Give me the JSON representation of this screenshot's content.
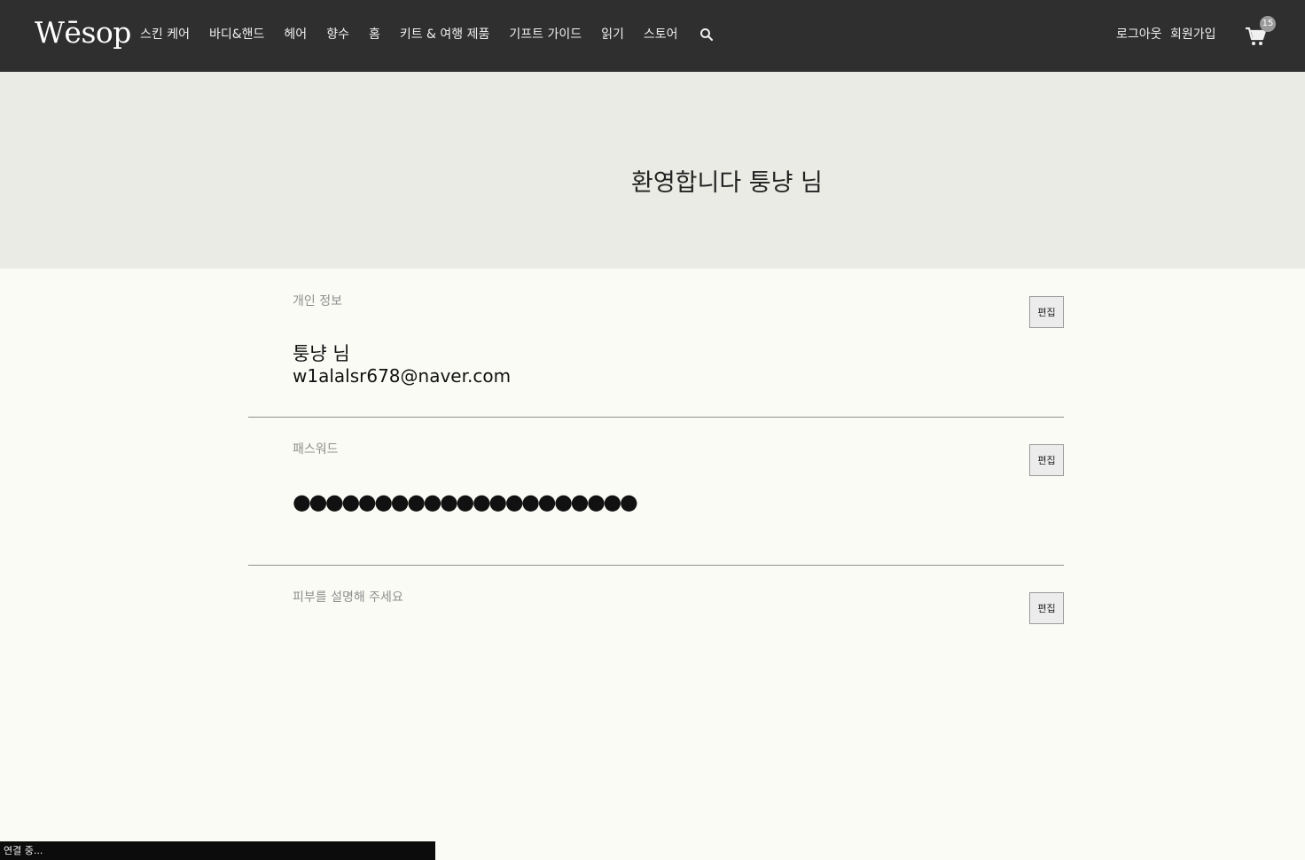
{
  "header": {
    "logo": "Wēsop",
    "nav_items": [
      "스킨 케어",
      "바디&핸드",
      "헤어",
      "향수",
      "홈",
      "키트 & 여행 제품",
      "기프트 가이드",
      "읽기",
      "스토어"
    ],
    "search_icon": "search-icon",
    "logout_label": "로그아웃",
    "signup_label": "회원가입",
    "cart_icon": "cart-icon",
    "cart_count": "15"
  },
  "hero": {
    "title": "환영합니다 퉁냥 님"
  },
  "profile": {
    "label": "개인 정보",
    "name": "퉁냥 님",
    "email": "w1alalsr678@naver.com",
    "edit_label": "편집"
  },
  "password": {
    "label": "패스워드",
    "mask": "●●●●●●●●●●●●●●●●●●●●●",
    "edit_label": "편집"
  },
  "skin": {
    "label": "피부를 설명해 주세요",
    "edit_label": "편집"
  },
  "status_bar": {
    "text": "연결 중..."
  },
  "colors": {
    "header_bg": "#2f2f2f",
    "hero_bg": "#ebebe5",
    "page_bg": "#fbfbf6",
    "divider": "#8f8f8f",
    "button_bg": "#ececec"
  }
}
